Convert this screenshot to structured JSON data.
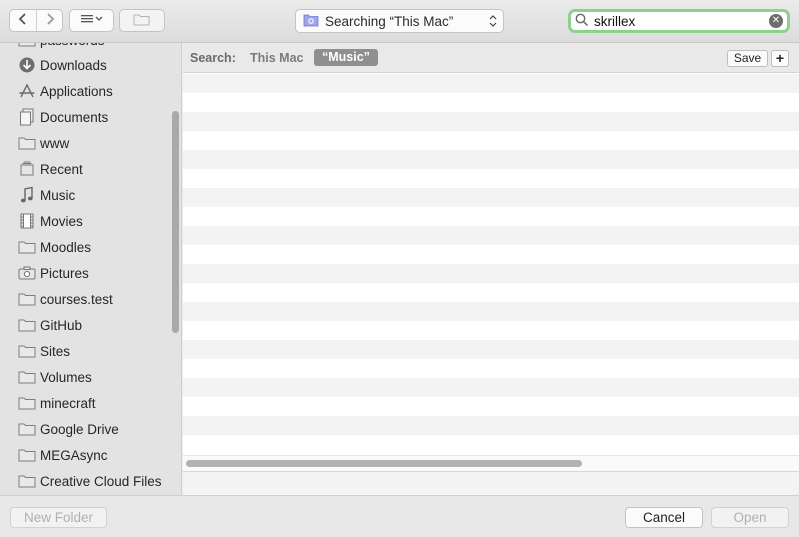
{
  "toolbar": {
    "location_popup": "Searching “This Mac”",
    "search_value": "skrillex",
    "back_icon": "chevron-left-icon",
    "forward_icon": "chevron-right-icon",
    "view_icon": "list-view-icon",
    "new_folder_icon": "folder-icon"
  },
  "sidebar": {
    "items": [
      {
        "label": "passwords",
        "icon": "folder-icon"
      },
      {
        "label": "Downloads",
        "icon": "download-icon"
      },
      {
        "label": "Applications",
        "icon": "applications-icon"
      },
      {
        "label": "Documents",
        "icon": "document-icon"
      },
      {
        "label": "www",
        "icon": "folder-icon"
      },
      {
        "label": "Recent",
        "icon": "recent-icon"
      },
      {
        "label": "Music",
        "icon": "music-icon"
      },
      {
        "label": "Movies",
        "icon": "movies-icon"
      },
      {
        "label": "Moodles",
        "icon": "folder-icon"
      },
      {
        "label": "Pictures",
        "icon": "camera-icon"
      },
      {
        "label": "courses.test",
        "icon": "folder-icon"
      },
      {
        "label": "GitHub",
        "icon": "folder-icon"
      },
      {
        "label": "Sites",
        "icon": "folder-icon"
      },
      {
        "label": "Volumes",
        "icon": "folder-icon"
      },
      {
        "label": "minecraft",
        "icon": "folder-icon"
      },
      {
        "label": "Google Drive",
        "icon": "folder-icon"
      },
      {
        "label": "MEGAsync",
        "icon": "folder-icon"
      },
      {
        "label": "Creative Cloud Files",
        "icon": "folder-icon"
      }
    ]
  },
  "scope": {
    "label": "Search:",
    "this_mac": "This Mac",
    "music": "“Music”",
    "save": "Save",
    "add": "+"
  },
  "footer": {
    "new_folder": "New Folder",
    "cancel": "Cancel",
    "open": "Open"
  },
  "colors": {
    "search_focus_ring": "#8fd08e",
    "selected_scope": "#8f8f8f"
  }
}
